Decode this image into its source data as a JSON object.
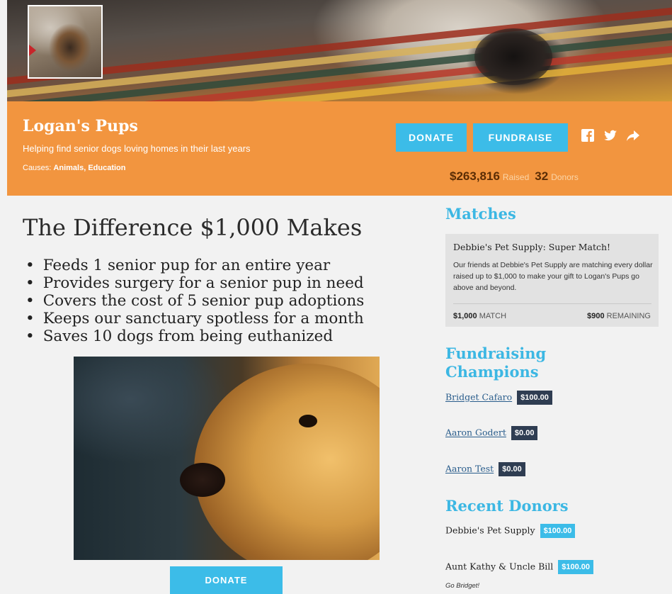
{
  "org": {
    "name": "Logan's Pups",
    "tagline": "Helping find senior dogs loving homes in their last years",
    "causes_label": "Causes:",
    "causes": "Animals, Education"
  },
  "header": {
    "donate_label": "DONATE",
    "fundraise_label": "FUNDRAISE",
    "social": {
      "facebook": "f",
      "twitter": "t",
      "share": "➦"
    },
    "raised_amount": "$263,816",
    "raised_label": "Raised",
    "donors_count": "32",
    "donors_label": "Donors"
  },
  "main": {
    "title": "The Difference $1,000 Makes",
    "bullets": [
      "Feeds 1 senior pup for an entire year",
      "Provides surgery for a senior pup in need",
      "Covers the cost of 5 senior pup adoptions",
      "Keeps our sanctuary spotless for a month",
      "Saves 10 dogs from being euthanized"
    ],
    "donate_label": "DONATE"
  },
  "sidebar": {
    "matches_heading": "Matches",
    "match": {
      "title": "Debbie's Pet Supply: Super Match!",
      "description": "Our friends at Debbie's Pet Supply are matching every dollar raised up to $1,000 to make your gift to Logan's Pups go above and beyond.",
      "amount": "$1,000",
      "amount_label": "MATCH",
      "remaining": "$900",
      "remaining_label": "REMAINING"
    },
    "champions_heading": "Fundraising Champions",
    "champions": [
      {
        "name": "Bridget Cafaro",
        "amount": "$100.00"
      },
      {
        "name": "Aaron Godert",
        "amount": "$0.00"
      },
      {
        "name": "Aaron Test",
        "amount": "$0.00"
      }
    ],
    "donors_heading": "Recent Donors",
    "donors": [
      {
        "name": "Debbie's Pet Supply",
        "amount": "$100.00",
        "note": ""
      },
      {
        "name": "Aunt Kathy & Uncle Bill",
        "amount": "$100.00",
        "note": "Go Bridget!"
      }
    ]
  },
  "colors": {
    "header": "#f2953f",
    "accent": "#3cbce8",
    "badge_dark": "#2f3d52"
  }
}
